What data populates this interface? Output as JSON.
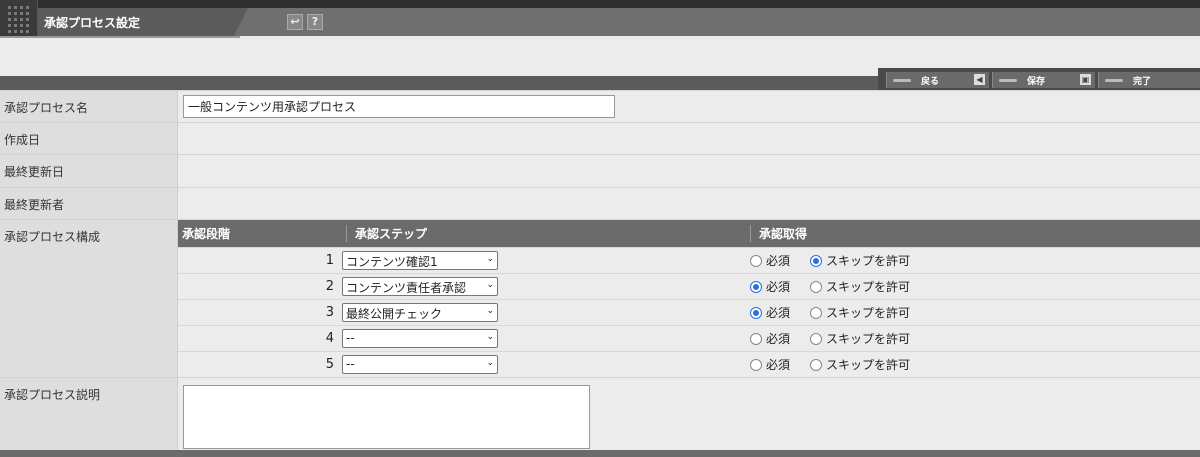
{
  "window": {
    "title": "承認プロセス設定"
  },
  "toolbar": {
    "back_label": "戻る",
    "save_label": "保存",
    "done_label": "完了"
  },
  "fields": {
    "name_label": "承認プロセス名",
    "name_value": "一般コンテンツ用承認プロセス",
    "created_label": "作成日",
    "updated_label": "最終更新日",
    "updated_by_label": "最終更新者",
    "structure_label": "承認プロセス構成",
    "description_label": "承認プロセス説明"
  },
  "steps_table": {
    "headers": [
      "承認段階",
      "承認ステップ",
      "承認取得"
    ],
    "required_label": "必須",
    "skip_label": "スキップを許可",
    "rows": [
      {
        "num": "1",
        "step": "コンテンツ確認1",
        "selected": "skip"
      },
      {
        "num": "2",
        "step": "コンテンツ責任者承認",
        "selected": "required"
      },
      {
        "num": "3",
        "step": "最終公開チェック",
        "selected": "required"
      },
      {
        "num": "4",
        "step": "--",
        "selected": "none"
      },
      {
        "num": "5",
        "step": "--",
        "selected": "none"
      }
    ]
  }
}
